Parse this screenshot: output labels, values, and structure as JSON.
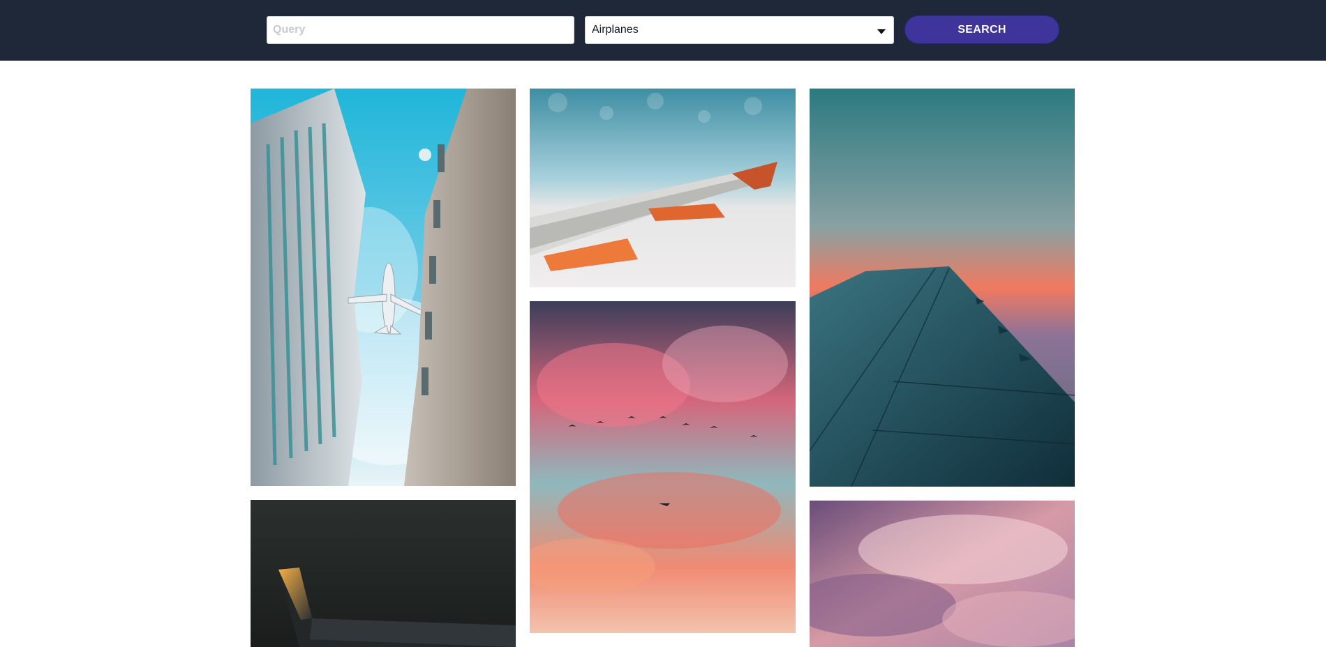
{
  "search": {
    "placeholder": "Query",
    "value": ""
  },
  "category_select": {
    "selected": "Airplanes"
  },
  "search_button": {
    "label": "SEARCH"
  },
  "colors": {
    "topbar_bg": "#1f2839",
    "button_bg": "#3e349b",
    "page_bg": "#ffffff"
  },
  "gallery": {
    "columns": 3,
    "photos": [
      {
        "subject": "airplane-between-buildings"
      },
      {
        "subject": "airplane-wing-over-clouds"
      },
      {
        "subject": "airplane-wing-at-sunset"
      },
      {
        "subject": "ryanair-wing-at-dusk"
      },
      {
        "subject": "birds-and-airplane-in-pink-sky"
      },
      {
        "subject": "pink-clouds"
      }
    ]
  }
}
